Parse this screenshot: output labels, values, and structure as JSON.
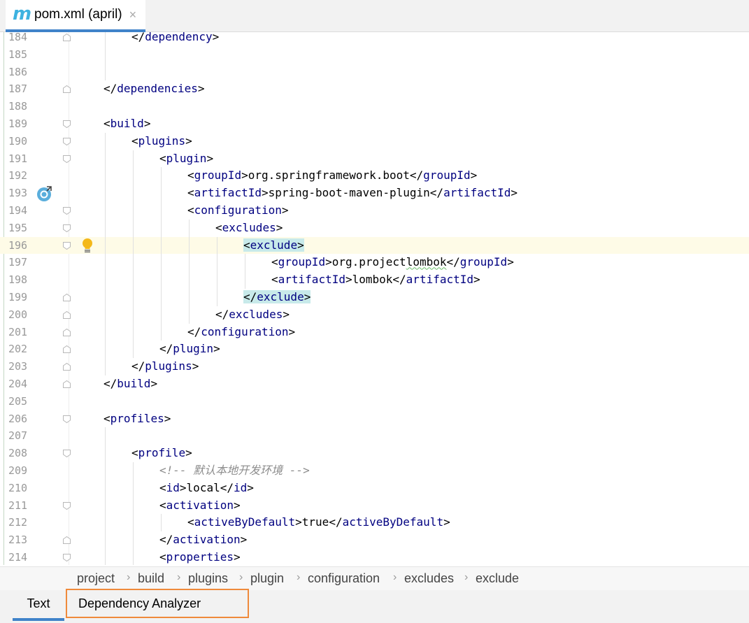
{
  "editor_tab": {
    "icon": "maven-m-icon",
    "icon_glyph": "m",
    "title": "pom.xml (april)",
    "close_glyph": "×"
  },
  "lines": [
    {
      "num": "184",
      "indent": 1,
      "parts": [
        [
          "t",
          "</"
        ],
        [
          "g",
          "dependency"
        ],
        [
          "t",
          ">"
        ]
      ]
    },
    {
      "num": "185",
      "indent": 0,
      "parts": []
    },
    {
      "num": "186",
      "indent": 0,
      "parts": []
    },
    {
      "num": "187",
      "indent": 0,
      "parts": [
        [
          "t",
          "</"
        ],
        [
          "g",
          "dependencies"
        ],
        [
          "t",
          ">"
        ]
      ]
    },
    {
      "num": "188",
      "indent": 0,
      "parts": []
    },
    {
      "num": "189",
      "indent": 0,
      "parts": [
        [
          "t",
          "<"
        ],
        [
          "g",
          "build"
        ],
        [
          "t",
          ">"
        ]
      ]
    },
    {
      "num": "190",
      "indent": 1,
      "parts": [
        [
          "t",
          "<"
        ],
        [
          "g",
          "plugins"
        ],
        [
          "t",
          ">"
        ]
      ]
    },
    {
      "num": "191",
      "indent": 2,
      "parts": [
        [
          "t",
          "<"
        ],
        [
          "g",
          "plugin"
        ],
        [
          "t",
          ">"
        ]
      ]
    },
    {
      "num": "192",
      "indent": 3,
      "parts": [
        [
          "t",
          "<"
        ],
        [
          "g",
          "groupId"
        ],
        [
          "t",
          ">"
        ],
        [
          "x",
          "org.springframework.boot"
        ],
        [
          "t",
          "</"
        ],
        [
          "g",
          "groupId"
        ],
        [
          "t",
          ">"
        ]
      ]
    },
    {
      "num": "193",
      "indent": 3,
      "parts": [
        [
          "t",
          "<"
        ],
        [
          "g",
          "artifactId"
        ],
        [
          "t",
          ">"
        ],
        [
          "x",
          "spring-boot-maven-plugin"
        ],
        [
          "t",
          "</"
        ],
        [
          "g",
          "artifactId"
        ],
        [
          "t",
          ">"
        ]
      ]
    },
    {
      "num": "194",
      "indent": 3,
      "parts": [
        [
          "t",
          "<"
        ],
        [
          "g",
          "configuration"
        ],
        [
          "t",
          ">"
        ]
      ]
    },
    {
      "num": "195",
      "indent": 4,
      "parts": [
        [
          "t",
          "<"
        ],
        [
          "g",
          "excludes"
        ],
        [
          "t",
          ">"
        ]
      ]
    },
    {
      "num": "196",
      "indent": 5,
      "hl": true,
      "current": true,
      "parts": [
        [
          "t",
          "<"
        ],
        [
          "g",
          "exclude"
        ],
        [
          "t",
          ">"
        ]
      ]
    },
    {
      "num": "197",
      "indent": 6,
      "parts": [
        [
          "t",
          "<"
        ],
        [
          "g",
          "groupId"
        ],
        [
          "t",
          ">"
        ],
        [
          "x",
          "org.project"
        ],
        [
          "s",
          "lombok"
        ],
        [
          "t",
          "</"
        ],
        [
          "g",
          "groupId"
        ],
        [
          "t",
          ">"
        ]
      ]
    },
    {
      "num": "198",
      "indent": 6,
      "parts": [
        [
          "t",
          "<"
        ],
        [
          "g",
          "artifactId"
        ],
        [
          "t",
          ">"
        ],
        [
          "x",
          "lombok"
        ],
        [
          "t",
          "</"
        ],
        [
          "g",
          "artifactId"
        ],
        [
          "t",
          ">"
        ]
      ]
    },
    {
      "num": "199",
      "indent": 5,
      "hl": true,
      "parts": [
        [
          "t",
          "</"
        ],
        [
          "g",
          "exclude"
        ],
        [
          "t",
          ">"
        ]
      ]
    },
    {
      "num": "200",
      "indent": 4,
      "parts": [
        [
          "t",
          "</"
        ],
        [
          "g",
          "excludes"
        ],
        [
          "t",
          ">"
        ]
      ]
    },
    {
      "num": "201",
      "indent": 3,
      "parts": [
        [
          "t",
          "</"
        ],
        [
          "g",
          "configuration"
        ],
        [
          "t",
          ">"
        ]
      ]
    },
    {
      "num": "202",
      "indent": 2,
      "parts": [
        [
          "t",
          "</"
        ],
        [
          "g",
          "plugin"
        ],
        [
          "t",
          ">"
        ]
      ]
    },
    {
      "num": "203",
      "indent": 1,
      "parts": [
        [
          "t",
          "</"
        ],
        [
          "g",
          "plugins"
        ],
        [
          "t",
          ">"
        ]
      ]
    },
    {
      "num": "204",
      "indent": 0,
      "parts": [
        [
          "t",
          "</"
        ],
        [
          "g",
          "build"
        ],
        [
          "t",
          ">"
        ]
      ]
    },
    {
      "num": "205",
      "indent": 0,
      "parts": []
    },
    {
      "num": "206",
      "indent": 0,
      "parts": [
        [
          "t",
          "<"
        ],
        [
          "g",
          "profiles"
        ],
        [
          "t",
          ">"
        ]
      ]
    },
    {
      "num": "207",
      "indent": 0,
      "parts": []
    },
    {
      "num": "208",
      "indent": 1,
      "parts": [
        [
          "t",
          "<"
        ],
        [
          "g",
          "profile"
        ],
        [
          "t",
          ">"
        ]
      ]
    },
    {
      "num": "209",
      "indent": 2,
      "parts": [
        [
          "c",
          "<!-- 默认本地开发环境 -->"
        ]
      ]
    },
    {
      "num": "210",
      "indent": 2,
      "parts": [
        [
          "t",
          "<"
        ],
        [
          "g",
          "id"
        ],
        [
          "t",
          ">"
        ],
        [
          "x",
          "local"
        ],
        [
          "t",
          "</"
        ],
        [
          "g",
          "id"
        ],
        [
          "t",
          ">"
        ]
      ]
    },
    {
      "num": "211",
      "indent": 2,
      "parts": [
        [
          "t",
          "<"
        ],
        [
          "g",
          "activation"
        ],
        [
          "t",
          ">"
        ]
      ]
    },
    {
      "num": "212",
      "indent": 3,
      "parts": [
        [
          "t",
          "<"
        ],
        [
          "g",
          "activeByDefault"
        ],
        [
          "t",
          ">"
        ],
        [
          "x",
          "true"
        ],
        [
          "t",
          "</"
        ],
        [
          "g",
          "activeByDefault"
        ],
        [
          "t",
          ">"
        ]
      ]
    },
    {
      "num": "213",
      "indent": 2,
      "parts": [
        [
          "t",
          "</"
        ],
        [
          "g",
          "activation"
        ],
        [
          "t",
          ">"
        ]
      ]
    },
    {
      "num": "214",
      "indent": 2,
      "parts": [
        [
          "t",
          "<"
        ],
        [
          "g",
          "properties"
        ],
        [
          "t",
          ">"
        ]
      ]
    }
  ],
  "breadcrumb": [
    "project",
    "build",
    "plugins",
    "plugin",
    "configuration",
    "excludes",
    "exclude"
  ],
  "bottom_tabs": {
    "text": "Text",
    "dependency_analyzer": "Dependency Analyzer"
  },
  "colors": {
    "tag": "#000080",
    "accent": "#4083c9",
    "highlight_border": "#ef8a3b",
    "current_line": "#fefbe7"
  }
}
